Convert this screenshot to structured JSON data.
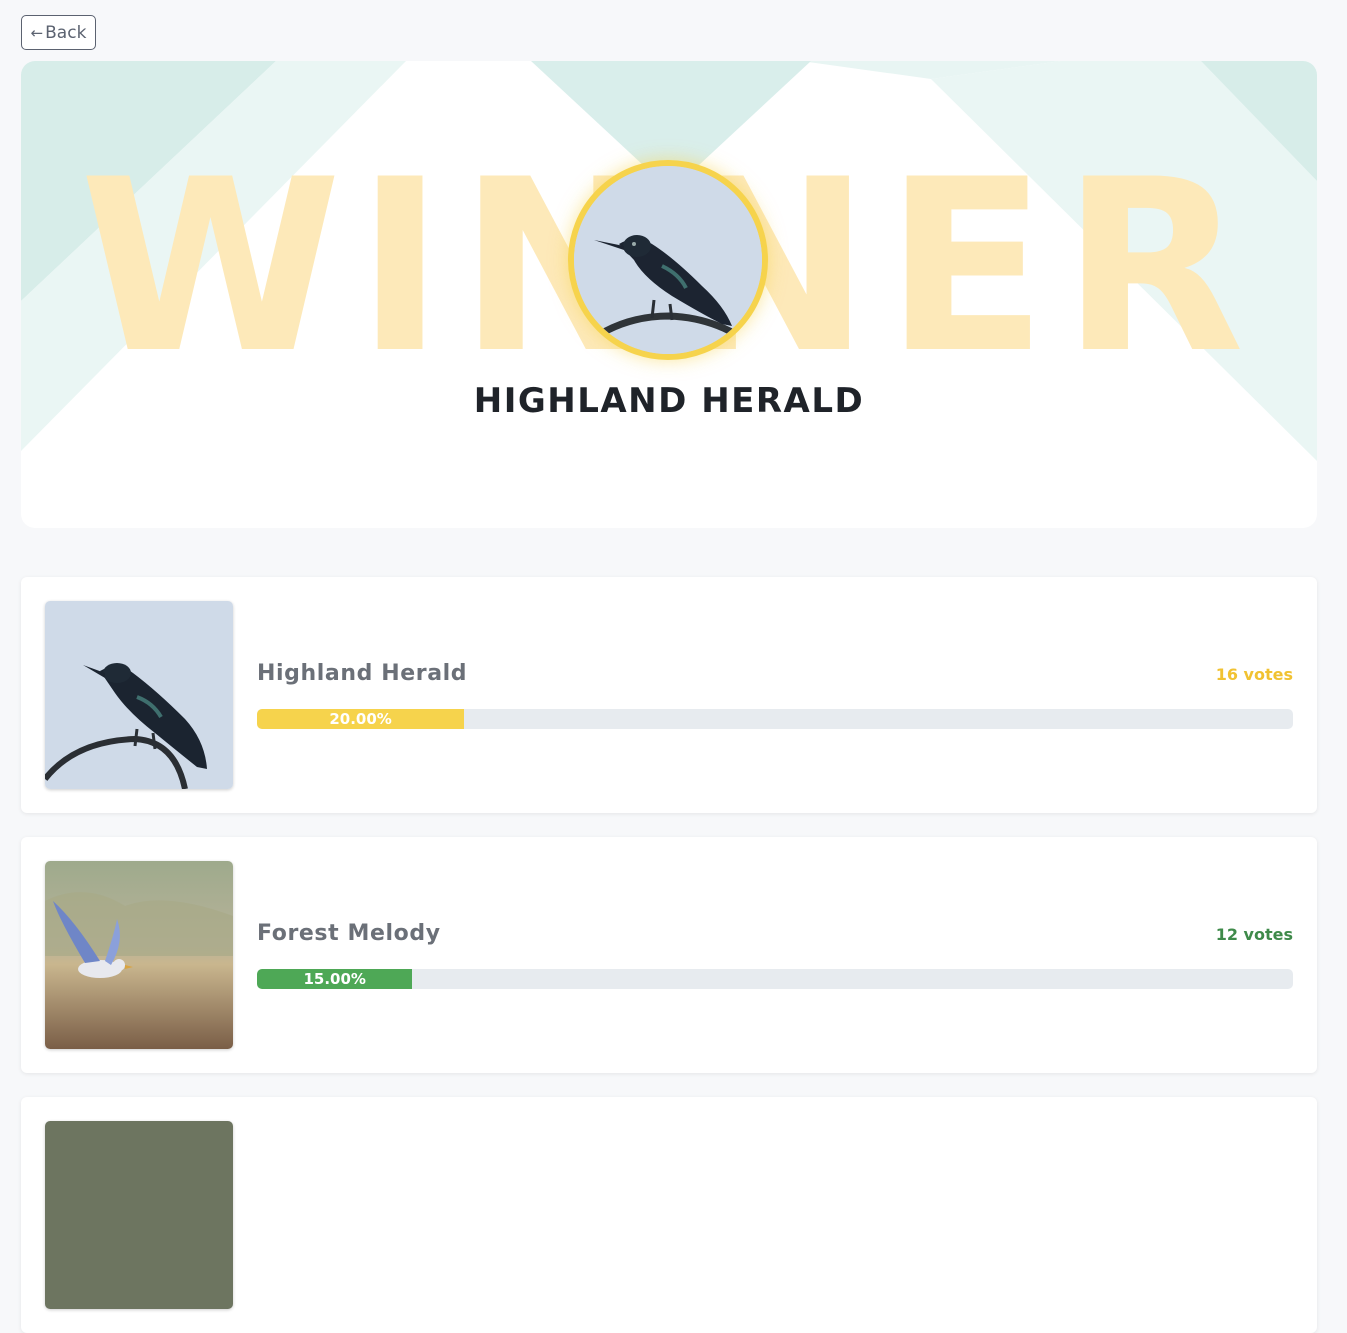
{
  "nav": {
    "back_label": "Back",
    "back_icon": "arrow-left-icon"
  },
  "hero": {
    "background_word": "WINNER",
    "winner_name": "HIGHLAND HERALD",
    "ring_color": "#f6d34c"
  },
  "entries": [
    {
      "name": "Highland Herald",
      "votes_label": "16 votes",
      "percent_label": "20.00%",
      "percent": 20.0,
      "color": "#f6d34c"
    },
    {
      "name": "Forest Melody",
      "votes_label": "12 votes",
      "percent_label": "15.00%",
      "percent": 15.0,
      "color": "#4ea856"
    }
  ],
  "colors": {
    "accent_gold": "#f6d34c",
    "accent_green": "#4ea856",
    "votes_gold": "#f1c232",
    "votes_green": "#3f8a4a",
    "track": "#e7ebef"
  }
}
